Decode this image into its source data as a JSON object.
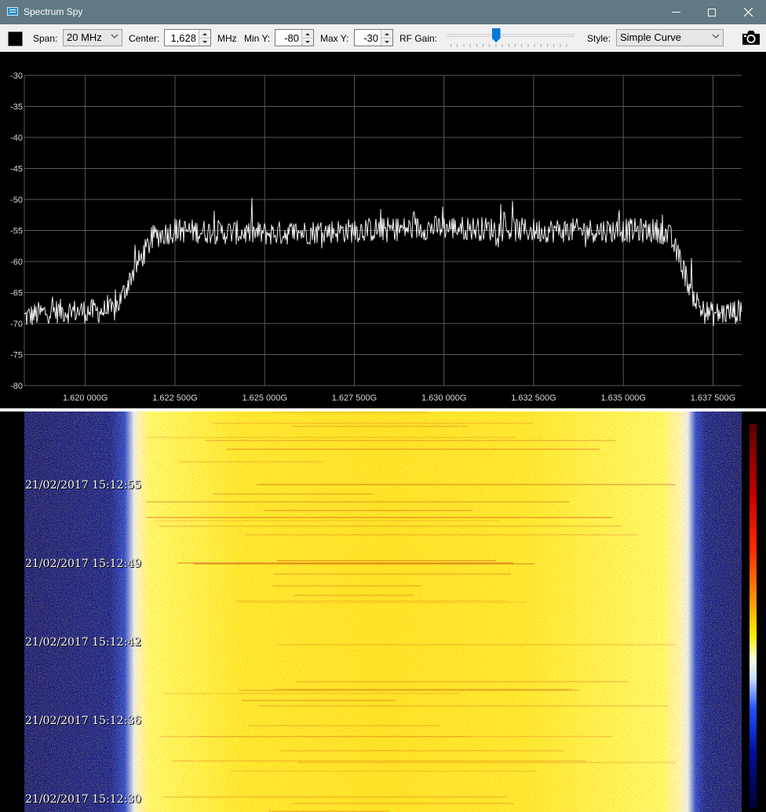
{
  "window": {
    "title": "Spectrum Spy"
  },
  "toolbar": {
    "span_label": "Span:",
    "span_value": "20 MHz",
    "center_label": "Center:",
    "center_value": "1,628",
    "center_unit": "MHz",
    "min_y_label": "Min Y:",
    "min_y_value": "-80",
    "max_y_label": "Max Y:",
    "max_y_value": "-30",
    "rf_gain_label": "RF Gain:",
    "rf_gain_level": 0.38,
    "style_label": "Style:",
    "style_value": "Simple Curve",
    "trace_color": "#000000"
  },
  "chart_data": {
    "type": "line",
    "xlim": [
      1618.3,
      1638.3
    ],
    "ylim": [
      -80,
      -30
    ],
    "grid": true,
    "x_tick_labels": [
      "1.620 000G",
      "1.622 500G",
      "1.625 000G",
      "1.627 500G",
      "1.630 000G",
      "1.632 500G",
      "1.635 000G",
      "1.637 500G"
    ],
    "x_ticks": [
      1620.0,
      1622.5,
      1625.0,
      1627.5,
      1630.0,
      1632.5,
      1635.0,
      1637.5
    ],
    "y_ticks": [
      -30,
      -35,
      -40,
      -45,
      -50,
      -55,
      -60,
      -65,
      -70,
      -75,
      -80
    ],
    "series": [
      {
        "line_color": "#ffffff",
        "x": [
          1618.3,
          1619.0,
          1620.0,
          1620.8,
          1621.0,
          1621.3,
          1621.6,
          1621.9,
          1622.5,
          1625.0,
          1627.5,
          1630.0,
          1632.5,
          1635.0,
          1636.0,
          1636.3,
          1636.6,
          1636.9,
          1637.2,
          1637.5,
          1638.3
        ],
        "values": [
          -69,
          -68,
          -68,
          -68,
          -66,
          -62,
          -59,
          -56,
          -55,
          -55.5,
          -55,
          -54.5,
          -55,
          -55,
          -55,
          -56,
          -60,
          -65,
          -68,
          -68.5,
          -68
        ]
      }
    ]
  },
  "waterfall": {
    "timestamps": [
      "21/02/2017 15:12:55",
      "21/02/2017 15:12:49",
      "21/02/2017 15:12:42",
      "21/02/2017 15:12:36",
      "21/02/2017 15:12:30"
    ]
  }
}
